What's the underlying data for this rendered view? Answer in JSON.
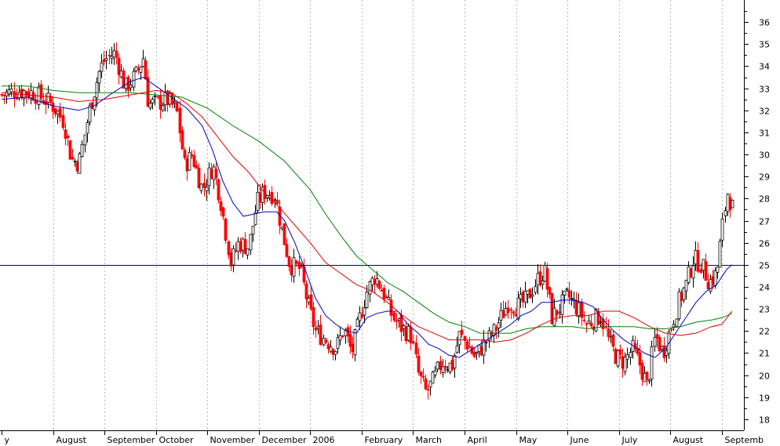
{
  "chart_data": {
    "type": "candlestick",
    "title": "",
    "xlabel": "",
    "ylabel": "",
    "ylim": [
      17.5,
      37
    ],
    "y_ticks": [
      18,
      19,
      20,
      21,
      22,
      23,
      24,
      25,
      26,
      27,
      28,
      29,
      30,
      31,
      32,
      33,
      34,
      35,
      36
    ],
    "grid": "vertical dotted at month starts",
    "x_labels": [
      {
        "label": "y",
        "x": 0
      },
      {
        "label": "August",
        "x": 1.0
      },
      {
        "label": "September",
        "x": 2.0
      },
      {
        "label": "October",
        "x": 3.0
      },
      {
        "label": "November",
        "x": 4.0
      },
      {
        "label": "December",
        "x": 5.0
      },
      {
        "label": "2006",
        "x": 6.0
      },
      {
        "label": "February",
        "x": 7.0
      },
      {
        "label": "March",
        "x": 8.0
      },
      {
        "label": "April",
        "x": 9.0
      },
      {
        "label": "May",
        "x": 10.0
      },
      {
        "label": "June",
        "x": 11.0
      },
      {
        "label": "July",
        "x": 12.0
      },
      {
        "label": "August",
        "x": 13.0
      },
      {
        "label": "Septemb",
        "x": 14.0
      }
    ],
    "reference_line": {
      "value": 25,
      "color": "#000080"
    },
    "price_path": [
      [
        0.0,
        32.7
      ],
      [
        0.3,
        32.9
      ],
      [
        0.6,
        32.8
      ],
      [
        0.9,
        32.4
      ],
      [
        1.0,
        32.2
      ],
      [
        1.2,
        31.5
      ],
      [
        1.35,
        29.8
      ],
      [
        1.5,
        29.6
      ],
      [
        1.7,
        32.0
      ],
      [
        1.9,
        33.8
      ],
      [
        2.0,
        34.3
      ],
      [
        2.2,
        34.6
      ],
      [
        2.4,
        33.0
      ],
      [
        2.6,
        33.6
      ],
      [
        2.75,
        34.4
      ],
      [
        2.85,
        32.3
      ],
      [
        3.0,
        32.3
      ],
      [
        3.2,
        32.5
      ],
      [
        3.4,
        32.0
      ],
      [
        3.55,
        29.5
      ],
      [
        3.7,
        30.0
      ],
      [
        3.9,
        28.4
      ],
      [
        4.1,
        29.5
      ],
      [
        4.25,
        28.0
      ],
      [
        4.45,
        25.1
      ],
      [
        4.6,
        26.0
      ],
      [
        4.8,
        25.8
      ],
      [
        4.95,
        27.8
      ],
      [
        5.1,
        28.3
      ],
      [
        5.3,
        28.2
      ],
      [
        5.45,
        26.5
      ],
      [
        5.6,
        25.0
      ],
      [
        5.8,
        24.8
      ],
      [
        5.95,
        23.2
      ],
      [
        6.1,
        22.0
      ],
      [
        6.3,
        21.6
      ],
      [
        6.5,
        21.2
      ],
      [
        6.65,
        22.1
      ],
      [
        6.8,
        21.0
      ],
      [
        6.95,
        22.5
      ],
      [
        7.1,
        23.8
      ],
      [
        7.25,
        24.5
      ],
      [
        7.45,
        23.6
      ],
      [
        7.6,
        22.6
      ],
      [
        7.75,
        22.2
      ],
      [
        7.95,
        21.8
      ],
      [
        8.1,
        20.0
      ],
      [
        8.25,
        19.2
      ],
      [
        8.4,
        19.8
      ],
      [
        8.55,
        20.6
      ],
      [
        8.75,
        20.4
      ],
      [
        8.9,
        21.8
      ],
      [
        9.05,
        21.4
      ],
      [
        9.2,
        20.8
      ],
      [
        9.4,
        21.5
      ],
      [
        9.55,
        21.9
      ],
      [
        9.7,
        22.6
      ],
      [
        9.85,
        23.3
      ],
      [
        10.0,
        23.1
      ],
      [
        10.2,
        23.4
      ],
      [
        10.4,
        24.3
      ],
      [
        10.55,
        24.7
      ],
      [
        10.7,
        22.6
      ],
      [
        10.85,
        23.1
      ],
      [
        11.0,
        23.6
      ],
      [
        11.2,
        23.0
      ],
      [
        11.35,
        22.3
      ],
      [
        11.5,
        22.5
      ],
      [
        11.65,
        22.7
      ],
      [
        11.8,
        21.5
      ],
      [
        11.95,
        20.8
      ],
      [
        12.1,
        20.6
      ],
      [
        12.25,
        21.2
      ],
      [
        12.4,
        20.5
      ],
      [
        12.55,
        19.5
      ],
      [
        12.7,
        21.8
      ],
      [
        12.85,
        21.0
      ],
      [
        13.0,
        22.1
      ],
      [
        13.15,
        23.3
      ],
      [
        13.3,
        24.1
      ],
      [
        13.45,
        25.3
      ],
      [
        13.6,
        25.0
      ],
      [
        13.75,
        24.2
      ],
      [
        13.9,
        24.6
      ],
      [
        14.0,
        26.6
      ],
      [
        14.1,
        28.3
      ],
      [
        14.2,
        27.6
      ]
    ],
    "series": [
      {
        "name": "",
        "color": "#0000c0",
        "points": [
          [
            0.0,
            32.5
          ],
          [
            0.5,
            32.6
          ],
          [
            1.0,
            32.2
          ],
          [
            1.5,
            32.0
          ],
          [
            1.8,
            32.2
          ],
          [
            2.1,
            32.7
          ],
          [
            2.5,
            33.3
          ],
          [
            2.75,
            33.5
          ],
          [
            3.0,
            33.1
          ],
          [
            3.3,
            32.6
          ],
          [
            3.6,
            32.1
          ],
          [
            3.9,
            31.3
          ],
          [
            4.1,
            30.2
          ],
          [
            4.3,
            28.8
          ],
          [
            4.5,
            27.8
          ],
          [
            4.7,
            27.2
          ],
          [
            4.9,
            27.3
          ],
          [
            5.1,
            27.4
          ],
          [
            5.35,
            27.4
          ],
          [
            5.5,
            27.0
          ],
          [
            5.7,
            26.0
          ],
          [
            5.9,
            24.8
          ],
          [
            6.1,
            23.5
          ],
          [
            6.3,
            22.7
          ],
          [
            6.5,
            22.3
          ],
          [
            6.7,
            22.0
          ],
          [
            6.9,
            21.9
          ],
          [
            7.1,
            22.6
          ],
          [
            7.3,
            22.8
          ],
          [
            7.5,
            22.9
          ],
          [
            7.7,
            22.9
          ],
          [
            7.9,
            22.3
          ],
          [
            8.1,
            21.9
          ],
          [
            8.3,
            21.4
          ],
          [
            8.5,
            21.2
          ],
          [
            8.7,
            20.9
          ],
          [
            8.9,
            20.8
          ],
          [
            9.1,
            21.1
          ],
          [
            9.3,
            21.4
          ],
          [
            9.5,
            21.7
          ],
          [
            9.7,
            22.0
          ],
          [
            9.9,
            22.3
          ],
          [
            10.1,
            22.7
          ],
          [
            10.3,
            22.9
          ],
          [
            10.5,
            23.3
          ],
          [
            10.7,
            23.3
          ],
          [
            10.9,
            23.4
          ],
          [
            11.1,
            23.4
          ],
          [
            11.3,
            23.3
          ],
          [
            11.5,
            23.1
          ],
          [
            11.7,
            22.5
          ],
          [
            11.9,
            22.0
          ],
          [
            12.1,
            21.6
          ],
          [
            12.3,
            21.3
          ],
          [
            12.5,
            21.0
          ],
          [
            12.7,
            20.8
          ],
          [
            12.9,
            21.2
          ],
          [
            13.1,
            21.9
          ],
          [
            13.3,
            22.6
          ],
          [
            13.5,
            23.3
          ],
          [
            13.7,
            23.8
          ],
          [
            13.9,
            24.1
          ],
          [
            14.1,
            24.8
          ],
          [
            14.2,
            25.0
          ]
        ]
      },
      {
        "name": "",
        "color": "#e00000",
        "points": [
          [
            0.0,
            32.8
          ],
          [
            0.5,
            32.7
          ],
          [
            1.0,
            32.6
          ],
          [
            1.5,
            32.4
          ],
          [
            2.0,
            32.5
          ],
          [
            2.5,
            32.7
          ],
          [
            3.0,
            32.9
          ],
          [
            3.3,
            32.8
          ],
          [
            3.6,
            32.3
          ],
          [
            3.9,
            31.7
          ],
          [
            4.2,
            30.8
          ],
          [
            4.5,
            29.9
          ],
          [
            4.8,
            29.2
          ],
          [
            5.1,
            28.3
          ],
          [
            5.4,
            27.6
          ],
          [
            5.7,
            26.8
          ],
          [
            6.0,
            26.0
          ],
          [
            6.3,
            25.1
          ],
          [
            6.6,
            24.6
          ],
          [
            6.9,
            24.1
          ],
          [
            7.2,
            23.8
          ],
          [
            7.5,
            23.3
          ],
          [
            7.8,
            22.7
          ],
          [
            8.1,
            22.2
          ],
          [
            8.4,
            21.9
          ],
          [
            8.7,
            21.6
          ],
          [
            9.0,
            21.6
          ],
          [
            9.3,
            21.6
          ],
          [
            9.6,
            21.5
          ],
          [
            9.9,
            21.6
          ],
          [
            10.2,
            21.9
          ],
          [
            10.5,
            22.3
          ],
          [
            10.8,
            22.6
          ],
          [
            11.1,
            22.7
          ],
          [
            11.4,
            22.7
          ],
          [
            11.7,
            22.9
          ],
          [
            12.0,
            22.9
          ],
          [
            12.3,
            22.6
          ],
          [
            12.6,
            22.2
          ],
          [
            12.9,
            21.9
          ],
          [
            13.2,
            21.8
          ],
          [
            13.5,
            21.9
          ],
          [
            13.8,
            22.2
          ],
          [
            14.0,
            22.3
          ],
          [
            14.2,
            22.9
          ]
        ]
      },
      {
        "name": "",
        "color": "#008000",
        "points": [
          [
            0.0,
            33.1
          ],
          [
            0.5,
            33.1
          ],
          [
            1.0,
            32.9
          ],
          [
            1.5,
            32.8
          ],
          [
            2.0,
            32.8
          ],
          [
            2.5,
            32.8
          ],
          [
            3.0,
            32.7
          ],
          [
            3.5,
            32.6
          ],
          [
            4.0,
            32.1
          ],
          [
            4.5,
            31.3
          ],
          [
            5.0,
            30.6
          ],
          [
            5.5,
            29.7
          ],
          [
            6.0,
            28.4
          ],
          [
            6.3,
            27.3
          ],
          [
            6.6,
            26.3
          ],
          [
            6.9,
            25.4
          ],
          [
            7.2,
            24.8
          ],
          [
            7.5,
            24.2
          ],
          [
            7.8,
            23.8
          ],
          [
            8.1,
            23.3
          ],
          [
            8.4,
            22.8
          ],
          [
            8.7,
            22.4
          ],
          [
            9.0,
            22.2
          ],
          [
            9.3,
            21.9
          ],
          [
            9.6,
            21.9
          ],
          [
            9.9,
            21.9
          ],
          [
            10.2,
            22.1
          ],
          [
            10.5,
            22.2
          ],
          [
            10.8,
            22.2
          ],
          [
            11.1,
            22.2
          ],
          [
            11.4,
            22.1
          ],
          [
            11.7,
            22.2
          ],
          [
            12.0,
            22.2
          ],
          [
            12.3,
            22.2
          ],
          [
            12.6,
            22.1
          ],
          [
            12.9,
            22.1
          ],
          [
            13.2,
            22.2
          ],
          [
            13.5,
            22.4
          ],
          [
            13.8,
            22.5
          ],
          [
            14.0,
            22.6
          ],
          [
            14.2,
            22.8
          ]
        ]
      }
    ]
  }
}
